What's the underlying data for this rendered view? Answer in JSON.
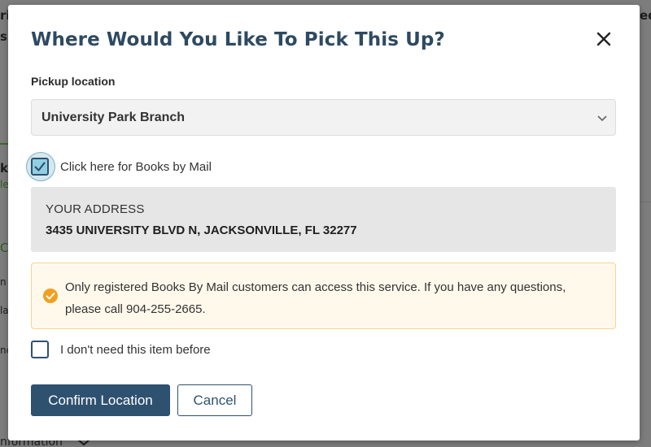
{
  "background": {
    "fragments": [
      "ri",
      "s'",
      "ed",
      "k",
      "le",
      "C",
      "n",
      "la",
      "nc",
      "nformation"
    ]
  },
  "dialog": {
    "title": "Where Would You Like To Pick This Up?",
    "close_icon": "close-icon",
    "pickup_label": "Pickup location",
    "pickup_selected": "University Park Branch",
    "books_by_mail": {
      "label": "Click here for Books by Mail",
      "checked": true
    },
    "address": {
      "caption": "YOUR ADDRESS",
      "value": "3435 UNIVERSITY BLVD N, JACKSONVILLE, FL 32277"
    },
    "notice": {
      "icon": "check-circle-icon",
      "text": "Only registered Books By Mail customers can access this service. If you have any questions, please call 904-255-2665."
    },
    "not_needed": {
      "label": "I don't need this item before",
      "checked": false
    },
    "confirm_label": "Confirm Location",
    "cancel_label": "Cancel"
  },
  "colors": {
    "title": "#2e4a62",
    "primary": "#2f5170",
    "notice_bg": "#fff9ec",
    "notice_border": "#f2d596",
    "notice_icon": "#f0a020",
    "checkbox_fill": "#90cfe4"
  }
}
